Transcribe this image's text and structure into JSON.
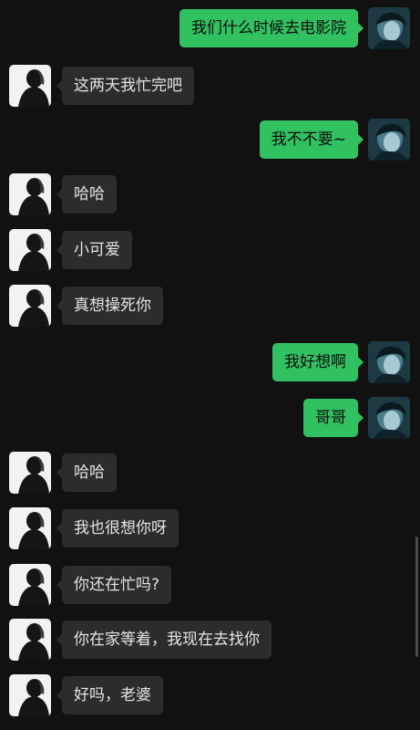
{
  "chat": {
    "messages": [
      {
        "side": "right",
        "text": "我们什么时候去电影院"
      },
      {
        "side": "left",
        "text": "这两天我忙完吧"
      },
      {
        "side": "right",
        "text": "我不不要~"
      },
      {
        "side": "left",
        "text": "哈哈"
      },
      {
        "side": "left",
        "text": "小可爱"
      },
      {
        "side": "left",
        "text": "真想操死你"
      },
      {
        "side": "right",
        "text": "我好想啊"
      },
      {
        "side": "right",
        "text": "哥哥"
      },
      {
        "side": "left",
        "text": "哈哈"
      },
      {
        "side": "left",
        "text": "我也很想你呀"
      },
      {
        "side": "left",
        "text": "你还在忙吗?"
      },
      {
        "side": "left",
        "text": "你在家等着，我现在去找你"
      },
      {
        "side": "left",
        "text": "好吗，老婆"
      }
    ]
  },
  "avatars": {
    "left": {
      "icon": "dark-portrait-avatar-icon",
      "bg": "#f2f2f2",
      "figure": "#151515"
    },
    "right": {
      "icon": "teal-portrait-avatar-icon",
      "bg": "#1d3a44",
      "figure": "#6fb6c7"
    }
  },
  "colors": {
    "background": "#111111",
    "sent_bubble": "#31c161",
    "received_bubble": "#2c2c2c"
  }
}
